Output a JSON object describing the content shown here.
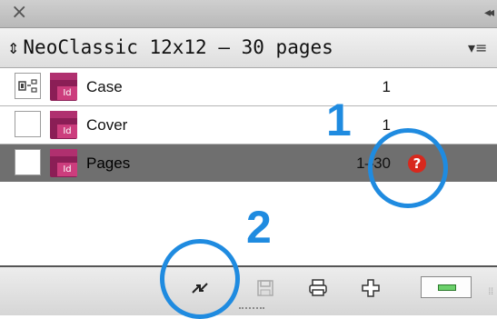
{
  "window": {
    "close_icon": "close-icon",
    "collapse_icon": "collapse-panel-icon"
  },
  "book": {
    "title": "NeoClassic 12x12 – 30 pages",
    "menu_icon": "panel-menu-icon"
  },
  "documents": [
    {
      "name": "Case",
      "pages": "1",
      "status_icon": "sync-source-icon",
      "selected": false,
      "warning": false
    },
    {
      "name": "Cover",
      "pages": "1",
      "status_icon": "",
      "selected": false,
      "warning": false
    },
    {
      "name": "Pages",
      "pages": "1–30",
      "status_icon": "",
      "selected": true,
      "warning": true,
      "warning_glyph": "?"
    }
  ],
  "doc_icon_label": "Id",
  "footer": {
    "sync_icon": "synchronize-icon",
    "save_icon": "save-book-icon",
    "print_icon": "print-book-icon",
    "add_icon": "add-document-icon",
    "remove_icon": "remove-document-icon"
  },
  "annotations": {
    "label_1": "1",
    "label_2": "2",
    "color": "#1f8be0"
  },
  "colors": {
    "selected_row": "#6f6f6f",
    "doc_icon": "#8b1e56",
    "warning": "#d8281d"
  }
}
